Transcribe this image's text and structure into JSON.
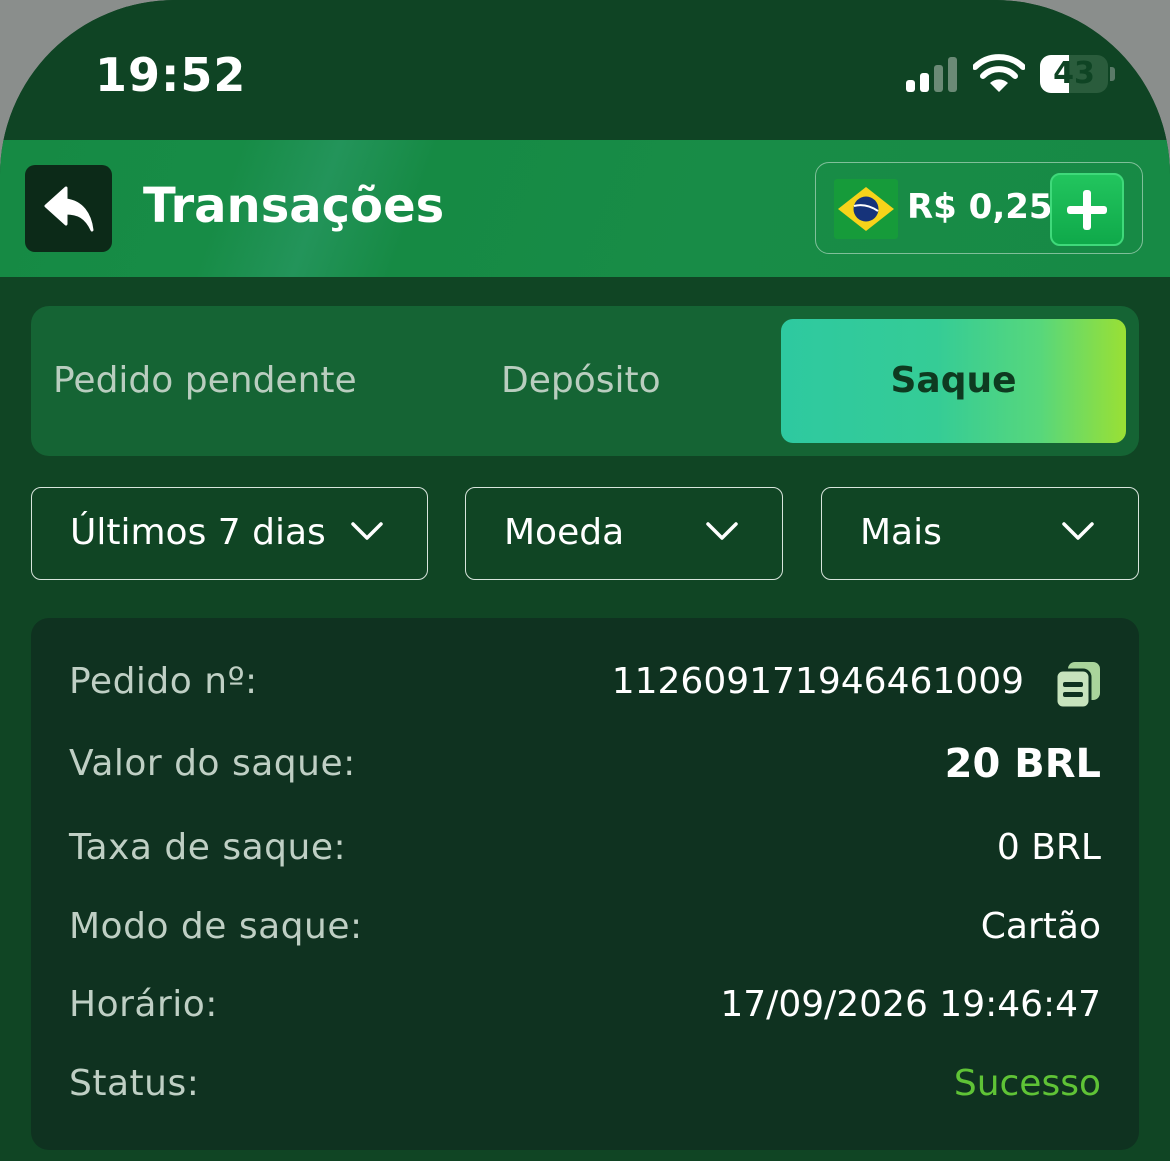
{
  "status_bar": {
    "time": "19:52",
    "battery": "43",
    "battery_level": 0.43
  },
  "header": {
    "title": "Transações",
    "balance": "R$ 0,25",
    "icons": [
      "back-arrow-icon",
      "brazil-flag-icon",
      "plus-icon"
    ]
  },
  "tabs": [
    {
      "label": "Pedido pendente",
      "active": false
    },
    {
      "label": "Depósito",
      "active": false
    },
    {
      "label": "Saque",
      "active": true
    }
  ],
  "filters": {
    "period": "Últimos 7 dias",
    "currency": "Moeda",
    "more": "Mais"
  },
  "details": {
    "order_label": "Pedido nº:",
    "order_value": "1126091719464610​09",
    "amount_label": "Valor do saque:",
    "amount_value": "20 BRL",
    "fee_label": "Taxa de saque:",
    "fee_value": "0 BRL",
    "mode_label": "Modo de saque:",
    "mode_value": "Cartão",
    "time_label": "Horário:",
    "time_value": "17/09/2026 19:46:47",
    "status_label": "Status:",
    "status_value": "Sucesso"
  },
  "colors": {
    "background": "#104524",
    "header": "#178a45",
    "tab_active_start": "#2ec9a0",
    "tab_active_end": "#9ae034",
    "card": "#0f3220",
    "success": "#5fc336"
  }
}
